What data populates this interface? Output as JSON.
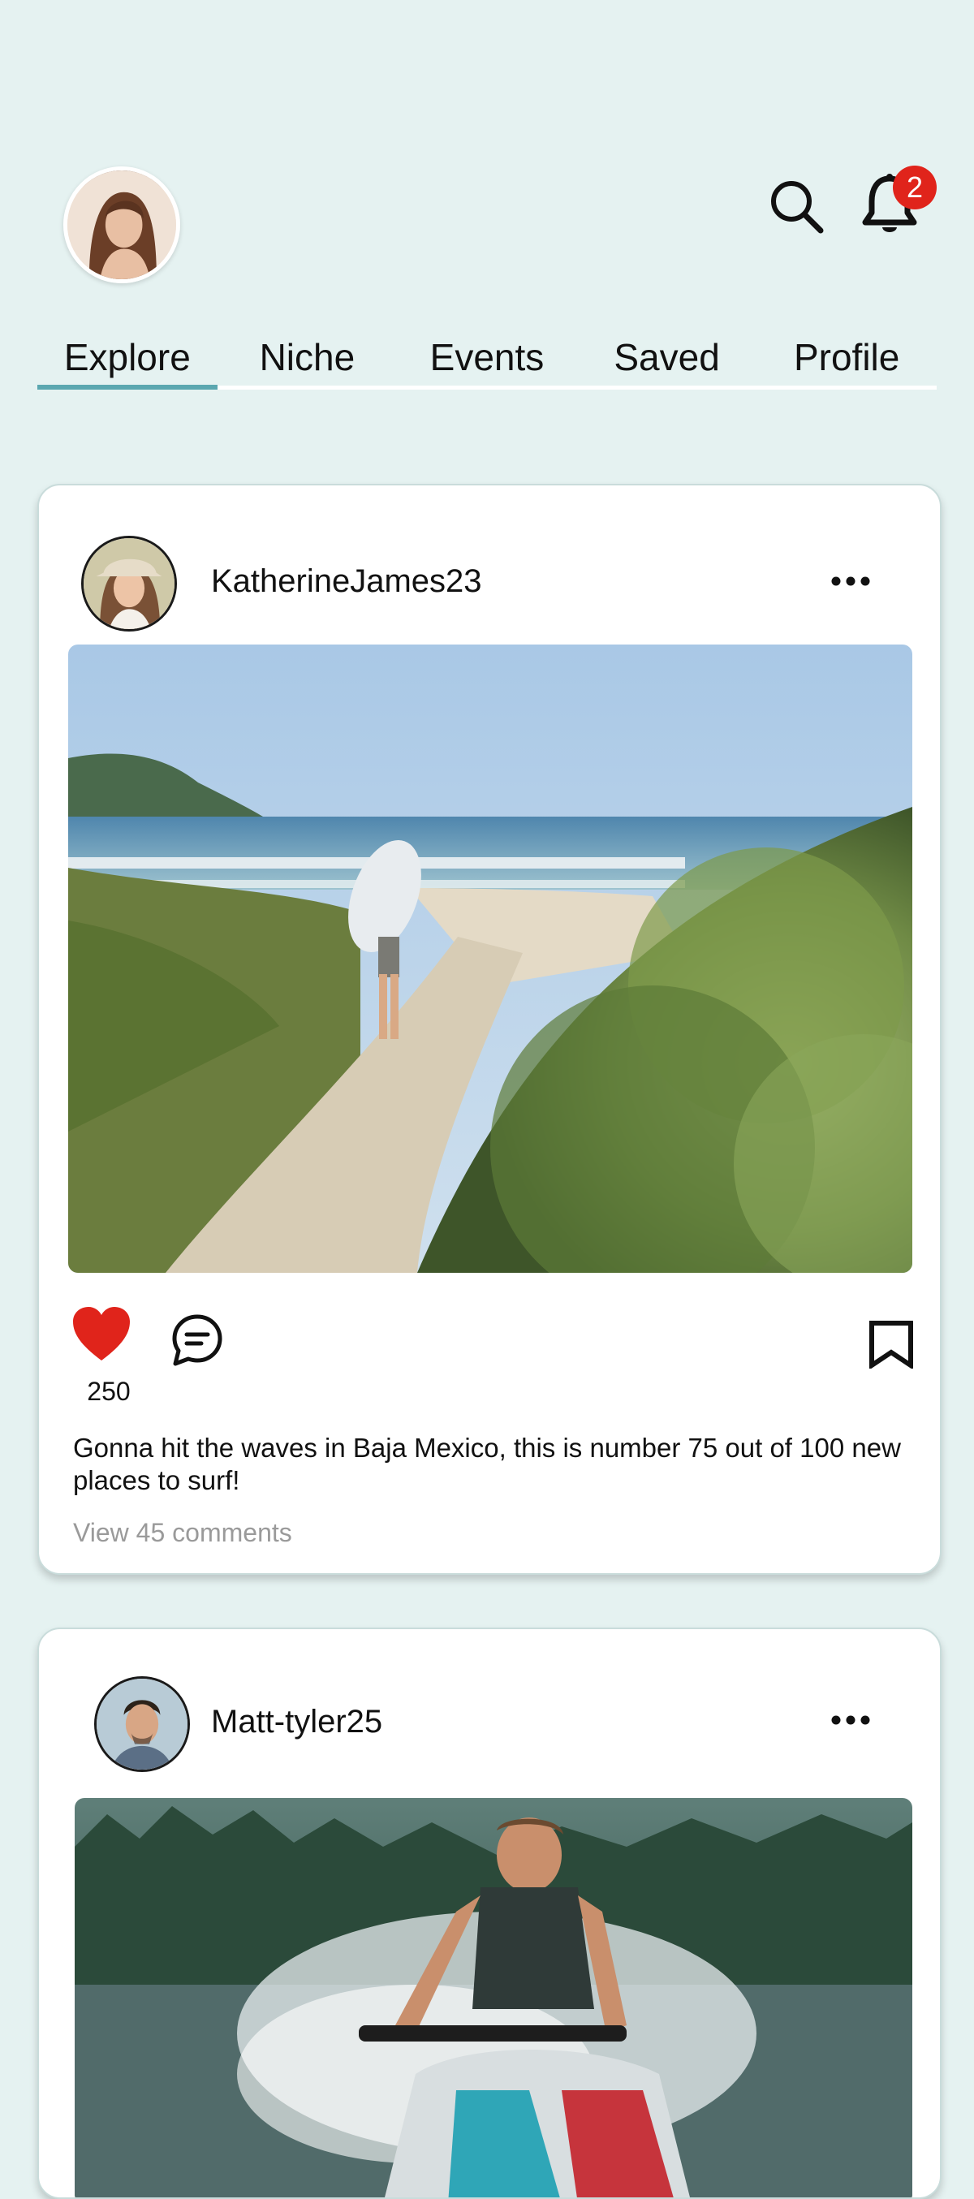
{
  "header": {
    "notification_count": "2"
  },
  "tabs": [
    {
      "label": "Explore",
      "active": true
    },
    {
      "label": "Niche",
      "active": false
    },
    {
      "label": "Events",
      "active": false
    },
    {
      "label": "Saved",
      "active": false
    },
    {
      "label": "Profile",
      "active": false
    }
  ],
  "posts": [
    {
      "username": "KatherineJames23",
      "likes": "250",
      "liked": true,
      "caption": "Gonna hit the waves in Baja Mexico, this is number 75 out of 100 new places to surf!",
      "comments_link": "View 45 comments"
    },
    {
      "username": "Matt-tyler25"
    }
  ],
  "colors": {
    "background": "#E5F2F1",
    "tab_active_underline": "#5BA7B0",
    "badge": "#E0241B",
    "like": "#E0241B"
  },
  "icons": {
    "search": "search-icon",
    "notifications": "bell-icon",
    "more": "more-horizontal-icon",
    "like": "heart-icon",
    "comment": "comment-icon",
    "save": "bookmark-icon"
  }
}
